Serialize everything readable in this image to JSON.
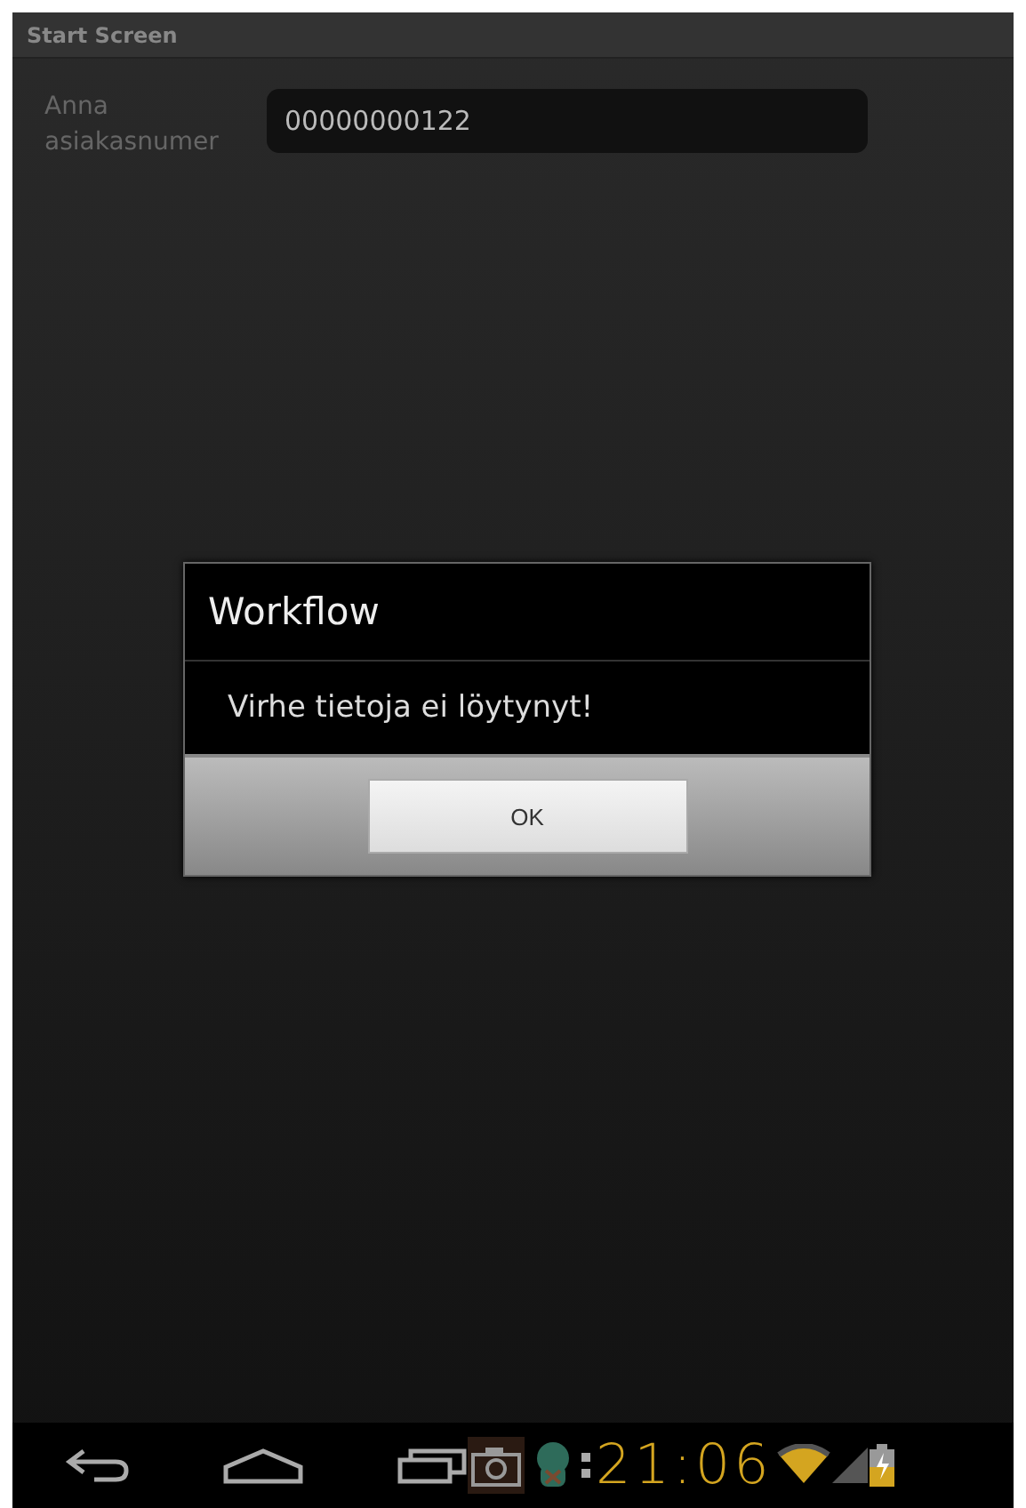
{
  "window": {
    "title": "Start Screen"
  },
  "form": {
    "label": "Anna asiakasnumer",
    "value": "00000000122"
  },
  "dialog": {
    "title": "Workflow",
    "message": "Virhe tietoja ei löytynyt!",
    "buttons": [
      "OK"
    ]
  },
  "system_bar": {
    "time": "21:06"
  }
}
